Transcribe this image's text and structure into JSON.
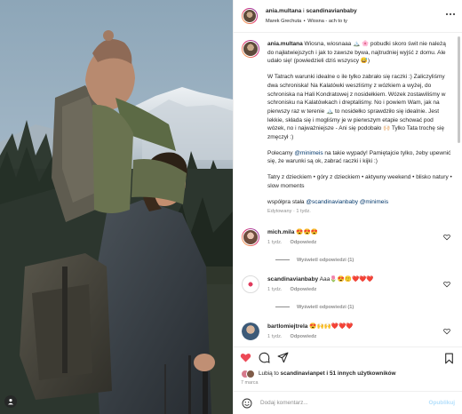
{
  "header": {
    "author": "ania.multana",
    "conjunction": "i",
    "coauthor": "scandinavianbaby",
    "audio_artist": "Marek Grechuta",
    "audio_separator": "•",
    "audio_track": "Wiosna - ach to ty"
  },
  "caption": {
    "username": "ania.multana",
    "paragraphs": [
      "Wiosna, wiosnaaa 🏔️ 🌸 pobudki skoro świt nie należą do najłatwiejszych i jak to zawsze bywa, najtrudniej wyjść z domu. Ale udało się! (powiedzieli dziś wszyscy 😅)",
      "W Tatrach warunki idealne o ile tylko zabrało się raczki :) Zaliczyliśmy dwa schroniska! Na Kalatówki weszliśmy z wózkiem a wyżej, do schroniska na Hali Kondratowej z nosidełkiem. Wózek zostawiliśmy w schronisku na Kalatówkach i dreptaliśmy. No i powiem Wam, jak na pierwszy raz w terenie 🏔️ to nosidełko sprawdziło się idealnie. Jest lekkie, składa się i mogliśmy je w pierwszym etapie schować pod wózek, no i najważniejsze - Ani się podobało 🙌🏻 Tylko Tata trochę się zmęczył :)"
    ],
    "polecamy_prefix": "Polecamy",
    "polecamy_mention": "@minimeis",
    "polecamy_suffix": "na takie wypady! Pamiętajcie tylko, żeby upewnić się, że warunki są ok, zabrać raczki i kijki :)",
    "tags": "Tatry z dzieckiem • góry z dzieckiem • aktywny weekend • blisko natury • slow moments",
    "collab_prefix": "współpra stała",
    "collab_mention_1": "@scandinavianbaby",
    "collab_mention_2": "@minimeis",
    "edited": "Edytowany",
    "edited_dot": "·",
    "time": "1 tydz."
  },
  "comments": [
    {
      "username": "mich.mila",
      "text": "😍😍😍",
      "time": "1 tydz.",
      "reply": "Odpowiedz",
      "view_replies": "Wyświetl odpowiedzi (1)"
    },
    {
      "username": "scandinavianbaby",
      "text": "Aaa🌷😍🙂❤️❤️❤️",
      "time": "1 tydz.",
      "reply": "Odpowiedz",
      "view_replies": "Wyświetl odpowiedzi (1)"
    },
    {
      "username": "bartlomiejtrela",
      "text": "😍🙌🙌❤️❤️❤️",
      "time": "1 tydz.",
      "reply": "Odpowiedz"
    }
  ],
  "likes": {
    "prefix": "Lubią to",
    "user": "scandinavianpet",
    "middle": "i",
    "others": "51 innych użytkowników"
  },
  "date": "7 marca",
  "composer": {
    "placeholder": "Dodaj komentarz...",
    "publish": "Opublikuj"
  },
  "colors": {
    "liked_heart": "#ed4956",
    "link": "#00376b",
    "muted": "#8e8e8e",
    "publish_disabled": "#b2dffc"
  },
  "icons": {
    "like": "heart-filled-icon",
    "comment": "comment-icon",
    "share": "paper-plane-icon",
    "save": "bookmark-icon",
    "more": "more-horizontal-icon",
    "emoji": "smiley-icon",
    "photo_user": "user-tag-icon",
    "comment_like": "heart-outline-icon"
  }
}
